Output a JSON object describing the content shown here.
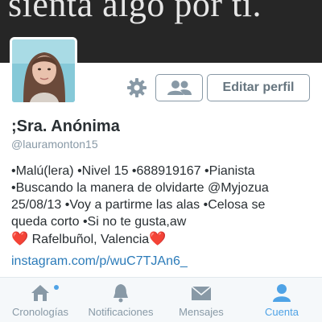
{
  "header": {
    "banner_text": "sienta algo por ti."
  },
  "profile": {
    "name": ";Sra. Anónima",
    "handle": "@lauramonton15",
    "bio_lines": [
      "•Malú(lera) •Nivel 15 •688919167 •Pianista",
      "•Buscando la manera de olvidarte @Myjozua",
      "25/08/13 •Voy a partirme las alas •Celosa se",
      "queda corto •Si no te gusta,aw"
    ],
    "location_heart_left": "❤️",
    "location": "Rafelbuñol, Valencia",
    "location_heart_right": "❤️",
    "link": "instagram.com/p/wuC7TJAn6_"
  },
  "actions": {
    "settings_icon": "gear-icon",
    "follow_icon": "people-icon",
    "edit_label": "Editar perfil"
  },
  "tabbar": {
    "tabs": [
      {
        "label": "Cronologías",
        "icon": "home-icon",
        "active": false,
        "badge": true
      },
      {
        "label": "Notificaciones",
        "icon": "bell-icon",
        "active": false,
        "badge": false
      },
      {
        "label": "Mensajes",
        "icon": "envelope-icon",
        "active": false,
        "badge": false
      },
      {
        "label": "Cuenta",
        "icon": "person-icon",
        "active": true,
        "badge": false
      }
    ]
  },
  "colors": {
    "accent": "#4fa3e6",
    "link": "#2b7bb9",
    "muted": "#8899a6",
    "banner": "#262626",
    "heart": "#e0245e"
  }
}
